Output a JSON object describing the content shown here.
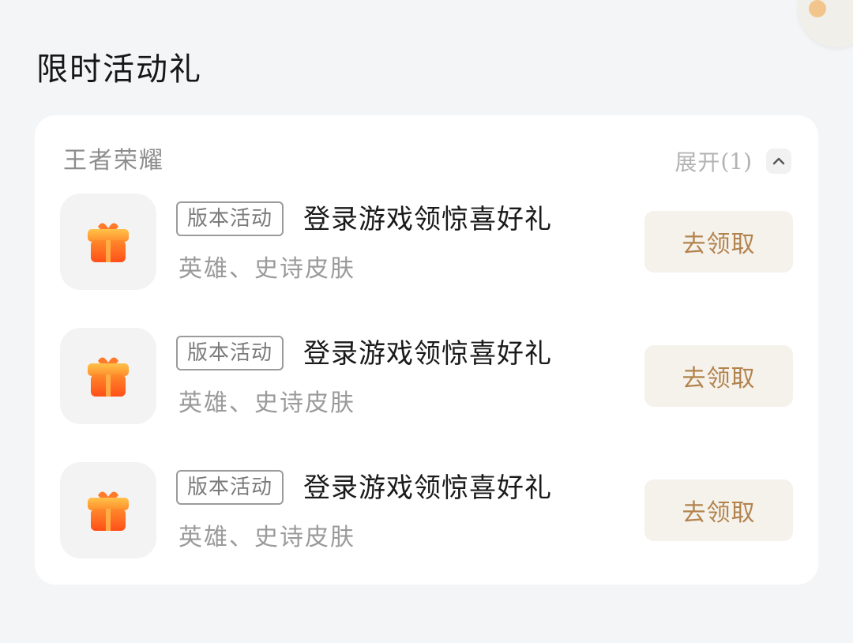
{
  "section": {
    "title": "限时活动礼"
  },
  "game_group": {
    "name": "王者荣耀",
    "expand_label": "展开",
    "expand_count": "(1)",
    "gifts": [
      {
        "tag": "版本活动",
        "title": "登录游戏领惊喜好礼",
        "description": "英雄、史诗皮肤",
        "button_label": "去领取",
        "icon": "gift-icon"
      },
      {
        "tag": "版本活动",
        "title": "登录游戏领惊喜好礼",
        "description": "英雄、史诗皮肤",
        "button_label": "去领取",
        "icon": "gift-icon"
      },
      {
        "tag": "版本活动",
        "title": "登录游戏领惊喜好礼",
        "description": "英雄、史诗皮肤",
        "button_label": "去领取",
        "icon": "gift-icon"
      }
    ]
  },
  "colors": {
    "page_background": "#f4f5f7",
    "card_background": "#ffffff",
    "button_background": "#f5f2ec",
    "button_text": "#b3834d",
    "gift_orange": "#ff6a1f",
    "gift_yellow": "#ffb13b"
  }
}
